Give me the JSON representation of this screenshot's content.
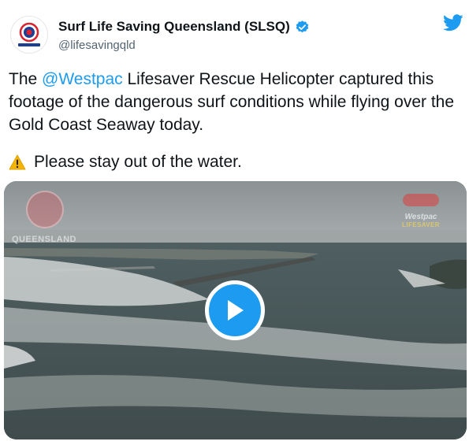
{
  "author": {
    "name": "Surf Life Saving Queensland (SLSQ)",
    "handle": "@lifesavingqld"
  },
  "tweet": {
    "text_before_mention": "The ",
    "mention": "@Westpac",
    "text_after_mention": " Lifesaver Rescue Helicopter captured this footage of the dangerous surf conditions while flying over the Gold Coast Seaway today.",
    "warning_text": "Please stay out of the water."
  },
  "video": {
    "watermark_left": "QUEENSLAND",
    "watermark_right_brand": "Westpac",
    "watermark_right_sub": "LIFESAVER"
  },
  "icons": {
    "avatar": "slsq-logo-icon",
    "verified": "verified-badge-icon",
    "brand": "twitter-bird-icon",
    "warning": "warning-emoji-icon",
    "play": "play-icon"
  },
  "colors": {
    "accent": "#1d9bf0",
    "text": "#0f1419",
    "secondary_text": "#536471",
    "warning": "#f4b400"
  }
}
